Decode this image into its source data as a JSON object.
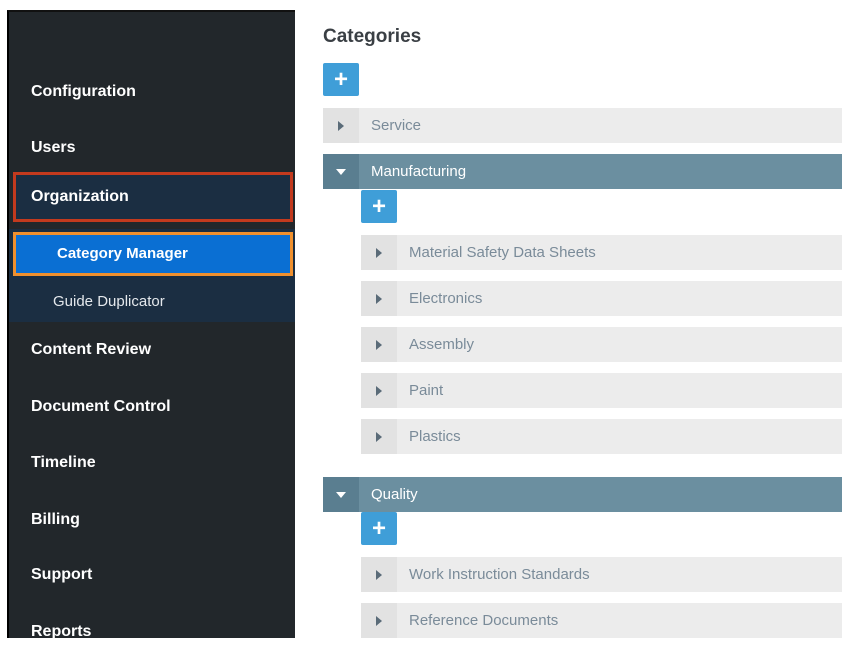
{
  "sidebar": {
    "items": [
      {
        "label": "Configuration"
      },
      {
        "label": "Users"
      },
      {
        "label": "Organization"
      },
      {
        "label": "Content Review"
      },
      {
        "label": "Document Control"
      },
      {
        "label": "Timeline"
      },
      {
        "label": "Billing"
      },
      {
        "label": "Support"
      },
      {
        "label": "Reports"
      }
    ],
    "sub_items": [
      {
        "label": "Category Manager"
      },
      {
        "label": "Guide Duplicator"
      }
    ]
  },
  "main": {
    "title": "Categories",
    "add_label": "+",
    "categories": [
      {
        "label": "Service",
        "state": "collapsed",
        "children": []
      },
      {
        "label": "Manufacturing",
        "state": "expanded",
        "children": [
          {
            "label": "Material Safety Data Sheets"
          },
          {
            "label": "Electronics"
          },
          {
            "label": "Assembly"
          },
          {
            "label": "Paint"
          },
          {
            "label": "Plastics"
          }
        ]
      },
      {
        "label": "Quality",
        "state": "expanded",
        "children": [
          {
            "label": "Work Instruction Standards"
          },
          {
            "label": "Reference Documents"
          }
        ]
      }
    ]
  },
  "colors": {
    "sidebar_bg": "#22272b",
    "sub_panel_bg": "#1b2e42",
    "active_item": "#0a6fd3",
    "highlight_red": "#c33a1e",
    "highlight_orange": "#f0902e",
    "add_button": "#3f9ed8",
    "expanded_row": "#6b8fa0",
    "collapsed_row": "#ececec"
  }
}
